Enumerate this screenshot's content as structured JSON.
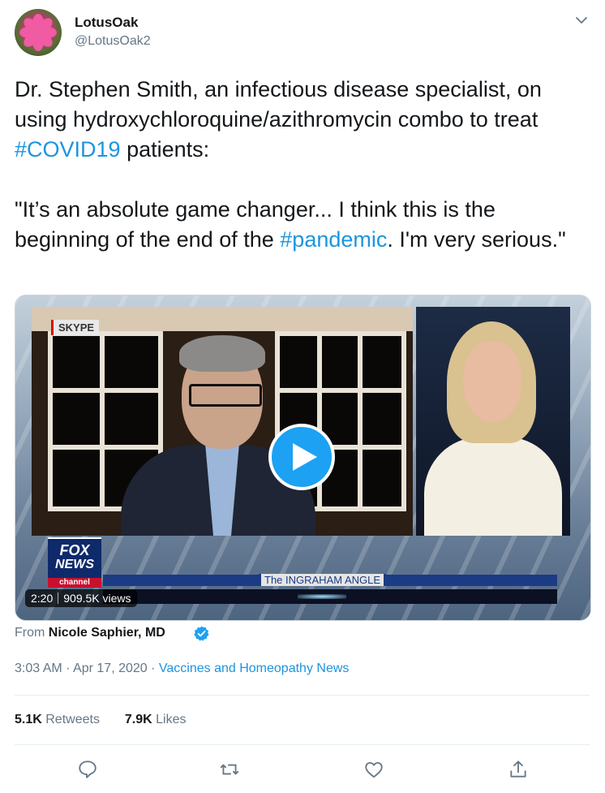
{
  "author": {
    "display_name": "LotusOak",
    "handle": "@LotusOak2"
  },
  "tweet": {
    "text_part1": "Dr. Stephen Smith, an infectious disease specialist, on using hydroxychloroquine/azithromycin combo to treat ",
    "hashtag1": "#COVID19",
    "text_part2": " patients:",
    "quote_part1": "\"It’s an absolute game changer... I think this is the beginning of the end of the ",
    "hashtag2": "#pandemic",
    "quote_part2": ". I'm very serious.\""
  },
  "video": {
    "duration": "2:20",
    "views": "909.5K views",
    "skype_label": "SKYPE",
    "network_logo_line1": "FOX",
    "network_logo_line2": "NEWS",
    "network_logo_line3": "channel",
    "show_name": "The INGRAHAM ANGLE"
  },
  "attribution": {
    "from_label": "From",
    "source": "Nicole Saphier, MD"
  },
  "meta": {
    "time": "3:03 AM",
    "separator": "·",
    "date": "Apr 17, 2020",
    "app": "Vaccines and Homeopathy News"
  },
  "stats": {
    "retweets_count": "5.1K",
    "retweets_label": "Retweets",
    "likes_count": "7.9K",
    "likes_label": "Likes"
  },
  "colors": {
    "link": "#1b95e0",
    "secondary_text": "#657786",
    "play_button": "#1da1f2"
  },
  "icons": [
    "chevron-down-icon",
    "verified-icon",
    "play-icon",
    "reply-icon",
    "retweet-icon",
    "like-icon",
    "share-icon"
  ]
}
